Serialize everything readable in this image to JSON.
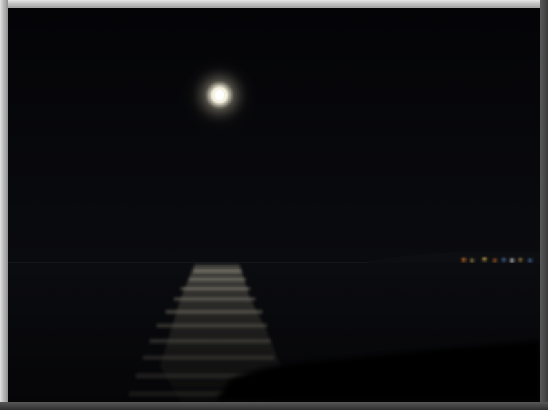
{
  "image": {
    "subject": "moon-over-sea-at-night",
    "colors": {
      "sky": "#050508",
      "sea": "#07080b",
      "moon": "#ffffff",
      "moon_glow": "#c9c2a8",
      "reflection": "#8f8a78",
      "shore_lights": [
        "#ff8c2a",
        "#ffd35a",
        "#6fa8ff",
        "#ffffff"
      ]
    },
    "frame": {
      "style": "beveled-gray-border",
      "light_color": "#e0e0e0",
      "dark_color": "#3a3a3a"
    }
  }
}
